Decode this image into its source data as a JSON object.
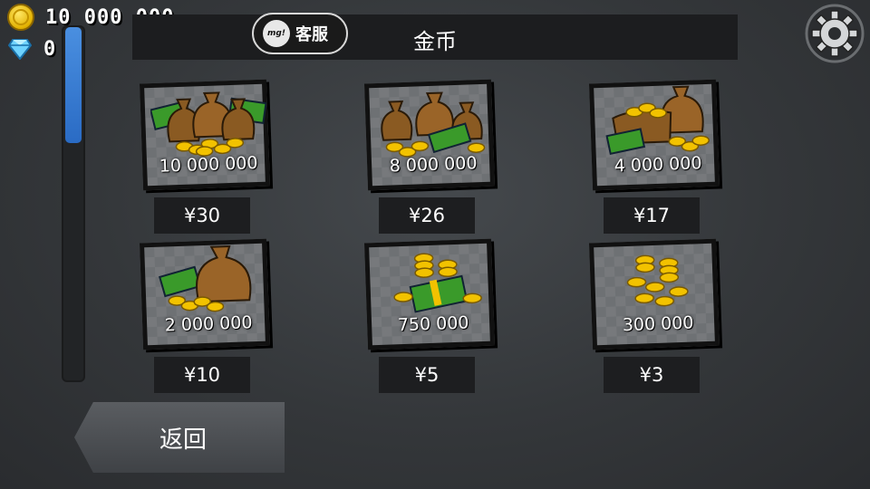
{
  "hud": {
    "coins": "10 000 000",
    "gems": "0"
  },
  "scrollbar": {
    "position": 0.0
  },
  "header": {
    "title": "金币",
    "service_label": "客服",
    "service_avatar_text": "mg!"
  },
  "items": [
    {
      "amount": "10 000 000",
      "price": "¥30",
      "art": "money-bags-cash-coins-icon"
    },
    {
      "amount": "8 000 000",
      "price": "¥26",
      "art": "money-bags-cash-coins-icon"
    },
    {
      "amount": "4 000 000",
      "price": "¥17",
      "art": "money-sack-coins-icon"
    },
    {
      "amount": "2 000 000",
      "price": "¥10",
      "art": "money-bag-coins-icon"
    },
    {
      "amount": "750 000",
      "price": "¥5",
      "art": "cash-coins-icon"
    },
    {
      "amount": "300 000",
      "price": "¥3",
      "art": "coin-pile-icon"
    }
  ],
  "back_label": "返回",
  "colors": {
    "coin": "#f2c200",
    "cash": "#3a9a2a",
    "bag": "#8a5a22",
    "accent_blue": "#3a7fd5"
  }
}
